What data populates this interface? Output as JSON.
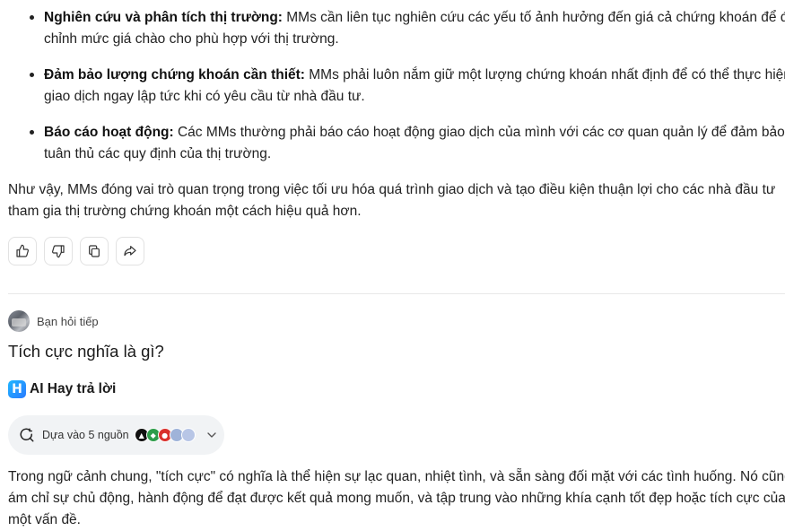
{
  "bullets": [
    {
      "bold": "Nghiên cứu và phân tích thị trường:",
      "line1": " MMs cần liên tục nghiên cứu các yếu tố ảnh hưởng đến giá cả chứng khoán để điều",
      "line2": "chỉnh mức giá chào cho phù hợp với thị trường."
    },
    {
      "bold": "Đảm bảo lượng chứng khoán cần thiết:",
      "line1": " MMs phải luôn nắm giữ một lượng chứng khoán nhất định để có thể thực hiện",
      "line2": "giao dịch ngay lập tức khi có yêu cầu từ nhà đầu tư."
    },
    {
      "bold": "Báo cáo hoạt động:",
      "line1": " Các MMs thường phải báo cáo hoạt động giao dịch của mình với các cơ quan quản lý để đảm bảo",
      "line2": "tuân thủ các quy định của thị trường."
    }
  ],
  "summary": {
    "line1": "Như vậy, MMs đóng vai trò quan trọng trong việc tối ưu hóa quá trình giao dịch và tạo điều kiện thuận lợi cho các nhà đầu tư",
    "line2": "tham gia thị trường chứng khoán một cách hiệu quả hơn."
  },
  "actions": [
    {
      "name": "like-button",
      "icon": "thumbs-up-icon"
    },
    {
      "name": "dislike-button",
      "icon": "thumbs-down-icon"
    },
    {
      "name": "copy-button",
      "icon": "copy-icon"
    },
    {
      "name": "share-button",
      "icon": "share-icon"
    }
  ],
  "followup": {
    "label": "Bạn hỏi tiếp"
  },
  "question": "Tích cực nghĩa là gì?",
  "ai": {
    "logo_letter": "H",
    "name": "AI Hay trả lời"
  },
  "sources": {
    "label": "Dựa vào 5 nguồn",
    "icon_colors": [
      "#111111",
      "#2e9c4a",
      "#d9302c",
      "#9fb3d9",
      "#b8c6e6"
    ]
  },
  "answer": {
    "line1": "Trong ngữ cảnh chung, \"tích cực\" có nghĩa là thể hiện sự lạc quan, nhiệt tình, và sẵn sàng đối mặt với các tình huống. Nó cũng",
    "line2": "ám chỉ sự chủ động, hành động để đạt được kết quả mong muốn, và tập trung vào những khía cạnh tốt đẹp hoặc tích cực của",
    "line3": "một vấn đề."
  }
}
